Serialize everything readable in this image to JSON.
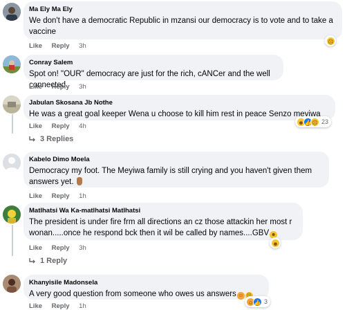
{
  "comments": [
    {
      "author": "Ma Ely Ma Ely",
      "text": "We don't have a democratic Republic in mzansi our democracy is to vote and to take a vaccine",
      "like": "Like",
      "reply": "Reply",
      "time": "3h",
      "reactions": {
        "icons": [
          "sad-reaction-icon"
        ],
        "count": ""
      }
    },
    {
      "author": "Conray Salem",
      "text": "Spot on! \"OUR\" democracy are just for the rich, cANCer and the well connected.",
      "like": "Like",
      "reply": "Reply",
      "time": "3h"
    },
    {
      "author": "Jabulan Skosana Jb Nothe",
      "text": "He was a great goal keeper Wena u choose to kill him rest in peace Senzo meyiwa",
      "like": "Like",
      "reply": "Reply",
      "time": "4h",
      "reactions": {
        "icons": [
          "haha-reaction-icon",
          "like-reaction-icon",
          "sad-reaction-icon"
        ],
        "count": "23"
      },
      "replies_label": "3 Replies"
    },
    {
      "author": "Kabelo Dimo Moela",
      "text": "Democracy my foot. The Meyiwa family is still crying and you haven't given them answers yet.",
      "like": "Like",
      "reply": "Reply",
      "time": "1h"
    },
    {
      "author": "Matlhatsi Wa Ka-matlhatsi Matlhatsi",
      "text": "The president is under fire frm all directions an cz those attackin her most r wonan.....once he respond bck then it wil be called by names....GBV",
      "like": "Like",
      "reply": "Reply",
      "time": "3h",
      "reactions": {
        "icons": [
          "haha-reaction-icon"
        ],
        "count": ""
      },
      "replies_label": "1 Reply"
    },
    {
      "author": "Khanyisile Madonsela",
      "text": "A very good question from someone who owes us answers",
      "like": "Like",
      "reply": "Reply",
      "time": "1h",
      "reactions": {
        "icons": [
          "care-reaction-icon",
          "like-reaction-icon"
        ],
        "count": "3"
      }
    }
  ],
  "colors": {
    "bubble": "#f0f2f5",
    "meta": "#65676b",
    "like_blue": "#1877f2",
    "haha_yellow": "#f7c42f"
  }
}
